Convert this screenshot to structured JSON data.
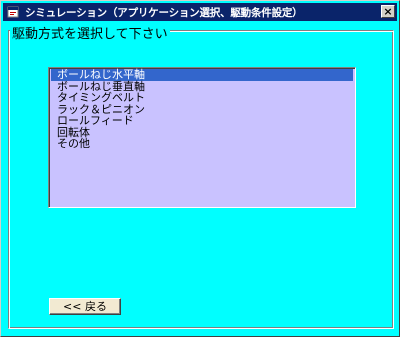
{
  "window": {
    "title": "シミュレーション（アプリケーション選択、駆動条件設定）",
    "close_label": "×"
  },
  "group": {
    "legend": "駆動方式を選択して下さい"
  },
  "listbox": {
    "selected_index": 0,
    "items": [
      {
        "label": "ボールねじ水平軸"
      },
      {
        "label": "ボールねじ垂直軸"
      },
      {
        "label": "タイミングベルト"
      },
      {
        "label": "ラック＆ピニオン"
      },
      {
        "label": "ロールフィード"
      },
      {
        "label": "回転体"
      },
      {
        "label": "その他"
      }
    ]
  },
  "buttons": {
    "back_label": "<< 戻る"
  },
  "colors": {
    "background": "#00ffff",
    "titlebar": "#0a246a",
    "listbox_bg": "#c9c2ff",
    "selection": "#3366cc",
    "button_bg": "#f2ead2"
  },
  "icons": {
    "app": "app-icon",
    "close": "close-icon"
  }
}
